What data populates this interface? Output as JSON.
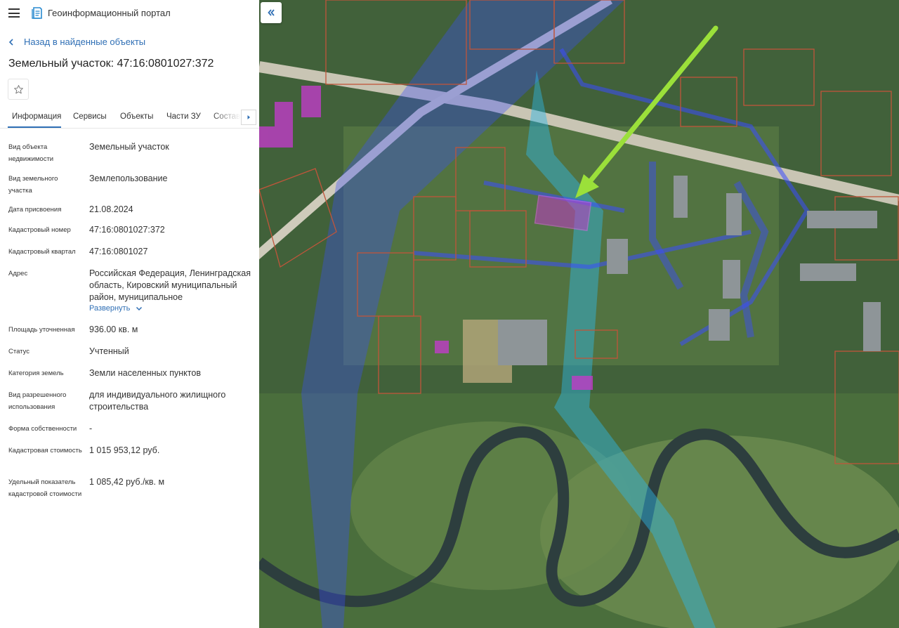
{
  "app": {
    "title": "Геоинформационный портал",
    "icons": {
      "menu": "hamburger-icon",
      "logo": "portal-logo-icon",
      "collapse": "double-chevron-left-icon"
    }
  },
  "nav": {
    "back_label": "Назад в найденные объекты"
  },
  "object": {
    "title": "Земельный участок: 47:16:0801027:372"
  },
  "tabs": [
    {
      "label": "Информация",
      "active": true
    },
    {
      "label": "Сервисы",
      "active": false
    },
    {
      "label": "Объекты",
      "active": false
    },
    {
      "label": "Части ЗУ",
      "active": false
    },
    {
      "label": "Состав",
      "active": false
    }
  ],
  "info": [
    {
      "label": "Вид объекта недвижимости",
      "value": "Земельный участок"
    },
    {
      "label": "Вид земельного участка",
      "value": "Землепользование"
    },
    {
      "label": "Дата присвоения",
      "value": "21.08.2024"
    },
    {
      "label": "Кадастровый номер",
      "value": "47:16:0801027:372"
    },
    {
      "label": "Кадастровый квартал",
      "value": "47:16:0801027"
    },
    {
      "label": "Адрес",
      "value": "Российская Федерация, Ленинградская область, Кировский муниципальный район, муниципальное"
    },
    {
      "label": "Площадь уточненная",
      "value": "936.00 кв. м"
    },
    {
      "label": "Статус",
      "value": "Учтенный"
    },
    {
      "label": "Категория земель",
      "value": "Земли населенных пунктов"
    },
    {
      "label": "Вид разрешенного использования",
      "value": "для индивидуального жилищного строительства"
    },
    {
      "label": "Форма собственности",
      "value": "-"
    },
    {
      "label": "Кадастровая стоимость",
      "value": "1 015 953,12 руб."
    },
    {
      "label": "Удельный показатель кадастровой стоимости",
      "value": "1 085,42 руб./кв. м"
    }
  ],
  "address_expand_label": "Развернуть",
  "colors": {
    "link": "#2f6fb5",
    "parcel_border": "#c0553a",
    "zone_blue": "#3a4cff",
    "zone_cyan": "#2fb7e8",
    "highlight_magenta": "#c03cc8",
    "arrow": "#9be03a"
  }
}
